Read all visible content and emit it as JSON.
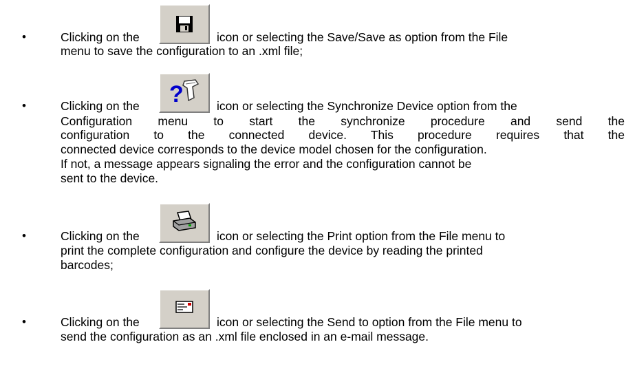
{
  "items": [
    {
      "icon": "floppy-disk-icon",
      "lines": [
        "Clicking on the",
        "icon or selecting the Save/Save as option from the File",
        "menu to save the configuration to an .xml file;"
      ]
    },
    {
      "icon": "synchronize-device-icon",
      "lines": [
        "Clicking on the",
        "icon or selecting the Synchronize Device option from the",
        "Configuration menu to start the synchronize procedure and send the",
        "configuration to the connected device. This procedure requires that the",
        "connected device corresponds to the device model chosen for the configuration.",
        "If not, a message appears signaling the error and the configuration cannot be",
        "sent to the device."
      ]
    },
    {
      "icon": "printer-icon",
      "lines": [
        "Clicking on the",
        "icon or selecting the Print option from the File menu to",
        "print the complete configuration and configure the device by reading the printed",
        "barcodes;"
      ]
    },
    {
      "icon": "send-mail-icon",
      "lines": [
        "Clicking on the",
        "icon or selecting the Send to option from the File menu to",
        "send the configuration as an .xml file enclosed in an e-mail message."
      ]
    }
  ]
}
